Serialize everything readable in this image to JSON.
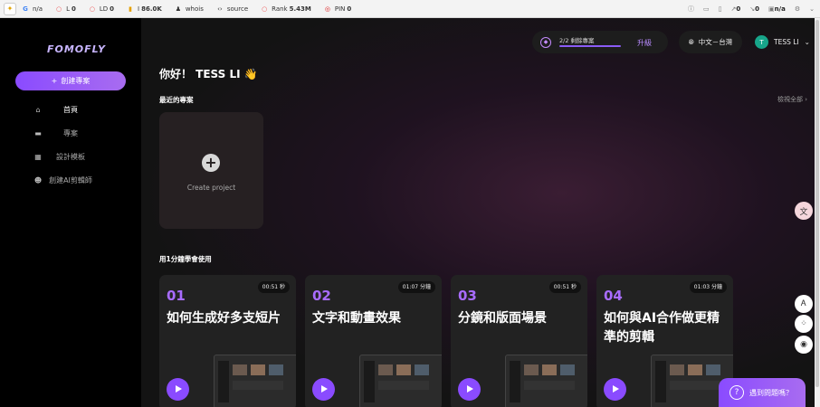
{
  "seo_bar": {
    "items": [
      {
        "label": "",
        "value": "n/a",
        "icon": "google-icon"
      },
      {
        "label": "L",
        "value": "0",
        "icon": "circle-icon"
      },
      {
        "label": "LD",
        "value": "0",
        "icon": "circle-icon"
      },
      {
        "label": "I",
        "value": "86.0K",
        "icon": "chart-icon"
      },
      {
        "label": "whois",
        "value": "",
        "icon": "user-icon"
      },
      {
        "label": "source",
        "value": "",
        "icon": "code-icon"
      },
      {
        "label": "Rank",
        "value": "5.43M",
        "icon": "circle-icon"
      },
      {
        "label": "PIN",
        "value": "0",
        "icon": "pinterest-icon"
      }
    ],
    "right_values": [
      "0",
      "0",
      "n/a"
    ]
  },
  "sidebar": {
    "brand": "FOMOFLY",
    "create_button": "創建專案",
    "items": [
      {
        "label": "首頁",
        "icon": "home-icon",
        "active": true
      },
      {
        "label": "專案",
        "icon": "folder-icon",
        "active": false
      },
      {
        "label": "設計模板",
        "icon": "grid-icon",
        "active": false
      },
      {
        "label": "創建AI剪輯師",
        "icon": "robot-icon",
        "active": false
      }
    ]
  },
  "header": {
    "plan_text": "2/2 剩餘專案",
    "upgrade": "升級",
    "language": "中文－台灣",
    "user_initial": "T",
    "user_name": "TESS LI"
  },
  "main": {
    "greeting": "你好！ TESS LI 👋",
    "recent_title": "最近的專案",
    "view_all": "檢視全部",
    "create_project": "Create project",
    "learn_title": "用1分鐘學會使用",
    "tutorials": [
      {
        "num": "01",
        "title": "如何生成好多支短片",
        "duration": "00:51 秒"
      },
      {
        "num": "02",
        "title": "文字和動畫效果",
        "duration": "01:07 分鐘"
      },
      {
        "num": "03",
        "title": "分鏡和版面場景",
        "duration": "00:51 秒"
      },
      {
        "num": "04",
        "title": "如何與AI合作做更精準的剪輯",
        "duration": "01:03 分鐘"
      }
    ],
    "help": "遇到問題嗎？"
  }
}
